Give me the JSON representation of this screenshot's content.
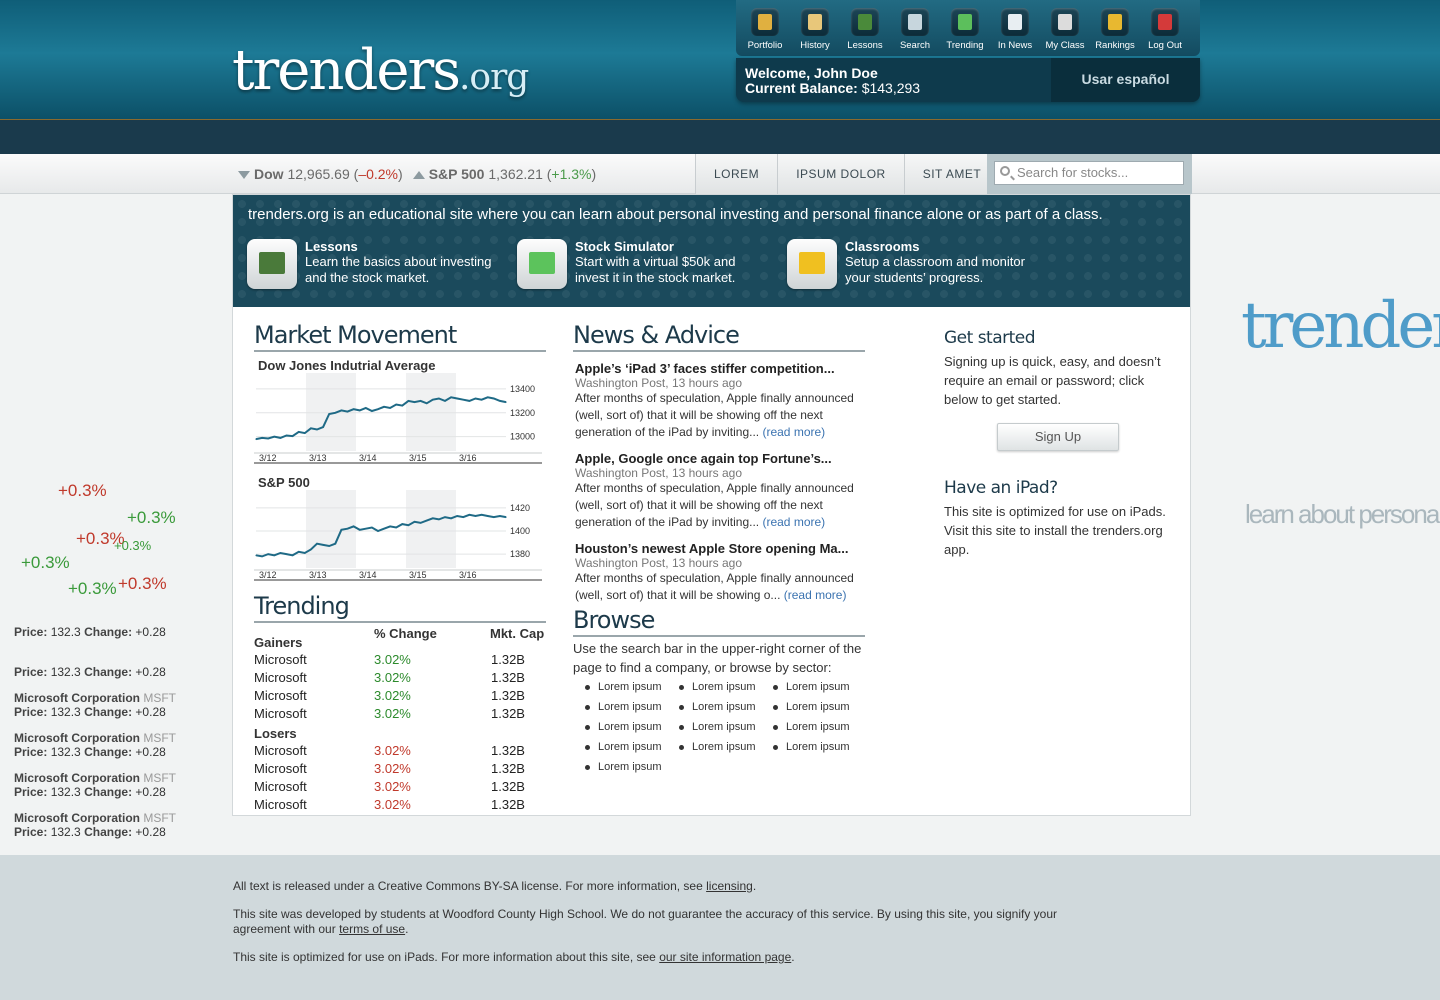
{
  "header": {
    "logo_main": "trenders",
    "logo_tld": ".org",
    "nav": [
      {
        "label": "Portfolio",
        "icon": "portfolio-icon",
        "color": "#e0b040"
      },
      {
        "label": "History",
        "icon": "history-icon",
        "color": "#e8c77a"
      },
      {
        "label": "Lessons",
        "icon": "lessons-icon",
        "color": "#4a8a3a"
      },
      {
        "label": "Search",
        "icon": "search-icon",
        "color": "#c7d6dd"
      },
      {
        "label": "Trending",
        "icon": "trending-icon",
        "color": "#5cbf5c"
      },
      {
        "label": "In News",
        "icon": "news-icon",
        "color": "#e8eef2"
      },
      {
        "label": "My Class",
        "icon": "class-icon",
        "color": "#dcdcdc"
      },
      {
        "label": "Rankings",
        "icon": "rankings-icon",
        "color": "#e8b830"
      },
      {
        "label": "Log Out",
        "icon": "logout-icon",
        "color": "#d43a3a"
      }
    ],
    "welcome": "Welcome, John Doe",
    "balance_label": "Current Balance:",
    "balance_value": "$143,293",
    "language_button": "Usar español"
  },
  "ticker": {
    "dow_label": "Dow",
    "dow_value": "12,965.69",
    "dow_change": "–0.2%",
    "sp_label": "S&P 500",
    "sp_value": "1,362.21",
    "sp_change": "+1.3%",
    "tabs": [
      "LOREM",
      "IPSUM DOLOR",
      "SIT AMET"
    ],
    "search_placeholder": "Search for stocks..."
  },
  "intro": {
    "text": "trenders.org is an educational site where you can learn about personal investing and personal finance alone or as part of a class.",
    "features": [
      {
        "title": "Lessons",
        "desc": "Learn the basics about investing and the stock market.",
        "icon": "chalkboard-icon",
        "color": "#4a7a3a"
      },
      {
        "title": "Stock Simulator",
        "desc": "Start with a virtual $50k and invest it in the stock market.",
        "icon": "chart-icon",
        "color": "#5cc35c"
      },
      {
        "title": "Classrooms",
        "desc": "Setup a classroom and monitor your students’ progress.",
        "icon": "school-bus-icon",
        "color": "#f0c020"
      }
    ]
  },
  "market": {
    "heading": "Market Movement",
    "dow_title": "Dow Jones Indutrial Average",
    "sp_title": "S&P 500"
  },
  "chart_data": [
    {
      "type": "line",
      "title": "Dow Jones Indutrial Average",
      "x_ticks": [
        "3/12",
        "3/13",
        "3/14",
        "3/15",
        "3/16"
      ],
      "y_ticks": [
        13400,
        13200,
        13000
      ],
      "ylim": [
        12880,
        13500
      ],
      "values": [
        12980,
        12990,
        12985,
        13000,
        12990,
        13010,
        13005,
        13040,
        13030,
        13070,
        13060,
        13080,
        13190,
        13200,
        13220,
        13210,
        13230,
        13220,
        13240,
        13215,
        13230,
        13250,
        13240,
        13270,
        13260,
        13300,
        13290,
        13300,
        13280,
        13310,
        13320,
        13300,
        13330,
        13320,
        13310,
        13300,
        13320,
        13310,
        13330,
        13320,
        13300,
        13290
      ]
    },
    {
      "type": "line",
      "title": "S&P 500",
      "x_ticks": [
        "3/12",
        "3/13",
        "3/14",
        "3/15",
        "3/16"
      ],
      "y_ticks": [
        1420,
        1400,
        1380
      ],
      "ylim": [
        1368,
        1432
      ],
      "values": [
        1379,
        1378,
        1380,
        1379,
        1381,
        1380,
        1379,
        1382,
        1381,
        1384,
        1389,
        1388,
        1387,
        1389,
        1401,
        1402,
        1404,
        1401,
        1402,
        1403,
        1400,
        1402,
        1404,
        1403,
        1406,
        1405,
        1408,
        1407,
        1409,
        1411,
        1410,
        1412,
        1411,
        1413,
        1412,
        1414,
        1413,
        1414,
        1413,
        1412,
        1413,
        1412
      ]
    }
  ],
  "trending": {
    "heading": "Trending",
    "col_change": "% Change",
    "col_cap": "Mkt. Cap",
    "gainers_label": "Gainers",
    "losers_label": "Losers",
    "gainers": [
      {
        "name": "Microsoft",
        "change": "3.02%",
        "cap": "1.32B"
      },
      {
        "name": "Microsoft",
        "change": "3.02%",
        "cap": "1.32B"
      },
      {
        "name": "Microsoft",
        "change": "3.02%",
        "cap": "1.32B"
      },
      {
        "name": "Microsoft",
        "change": "3.02%",
        "cap": "1.32B"
      }
    ],
    "losers": [
      {
        "name": "Microsoft",
        "change": "3.02%",
        "cap": "1.32B"
      },
      {
        "name": "Microsoft",
        "change": "3.02%",
        "cap": "1.32B"
      },
      {
        "name": "Microsoft",
        "change": "3.02%",
        "cap": "1.32B"
      },
      {
        "name": "Microsoft",
        "change": "3.02%",
        "cap": "1.32B"
      }
    ]
  },
  "news": {
    "heading": "News & Advice",
    "read_more": "(read more)",
    "items": [
      {
        "title": "Apple’s ‘iPad 3’ faces stiffer competition...",
        "source": "Washington Post, 13 hours ago",
        "body": "After months of speculation, Apple finally announced (well, sort of) that it will be showing off the next generation of the iPad by inviting..."
      },
      {
        "title": "Apple, Google once again top Fortune’s...",
        "source": "Washington Post, 13 hours ago",
        "body": "After months of speculation, Apple finally announced (well, sort of) that it will be showing off the next generation of the iPad by inviting..."
      },
      {
        "title": "Houston’s newest Apple Store opening Ma...",
        "source": "Washington Post, 13 hours ago",
        "body": "After months of speculation, Apple finally announced (well, sort of) that it will be showing o..."
      }
    ]
  },
  "browse": {
    "heading": "Browse",
    "text": "Use the search bar in the upper-right corner of the page to find a company, or browse by sector:",
    "sectors": [
      "Lorem ipsum",
      "Lorem ipsum",
      "Lorem ipsum",
      "Lorem ipsum",
      "Lorem ipsum",
      "Lorem ipsum",
      "Lorem ipsum",
      "Lorem ipsum",
      "Lorem ipsum",
      "Lorem ipsum",
      "Lorem ipsum",
      "Lorem ipsum",
      "Lorem ipsum"
    ]
  },
  "sidebar": {
    "get_started_heading": "Get started",
    "get_started_text": "Signing up is quick, easy, and doesn’t require an email or password; click below to get started.",
    "signup_button": "Sign Up",
    "ipad_heading": "Have an iPad?",
    "ipad_text": "This site is optimized for use on iPads. Visit this site to install the trenders.org app."
  },
  "background_left": {
    "floats": [
      {
        "text": "+0.3%",
        "color": "#c0392b"
      },
      {
        "text": "+0.3%",
        "color": "#3a9a3a"
      },
      {
        "text": "+0.3%",
        "color": "#c0392b"
      },
      {
        "text": "+0.3%",
        "color": "#3a9a3a"
      },
      {
        "text": "+0.3%",
        "color": "#3a9a3a"
      },
      {
        "text": "+0.3%",
        "color": "#3a9a3a"
      },
      {
        "text": "+0.3%",
        "color": "#c0392b"
      }
    ],
    "stocks": [
      {
        "name": "",
        "ticker": "",
        "price_label": "Price:",
        "price": "132.3",
        "change_label": "Change:",
        "change": "+0.28"
      },
      {
        "name": "",
        "ticker": "",
        "price_label": "Price:",
        "price": "132.3",
        "change_label": "Change:",
        "change": "+0.28"
      },
      {
        "name": "Microsoft Corporation",
        "ticker": "MSFT",
        "price_label": "Price:",
        "price": "132.3",
        "change_label": "Change:",
        "change": "+0.28"
      },
      {
        "name": "Microsoft Corporation",
        "ticker": "MSFT",
        "price_label": "Price:",
        "price": "132.3",
        "change_label": "Change:",
        "change": "+0.28"
      },
      {
        "name": "Microsoft Corporation",
        "ticker": "MSFT",
        "price_label": "Price:",
        "price": "132.3",
        "change_label": "Change:",
        "change": "+0.28"
      },
      {
        "name": "Microsoft Corporation",
        "ticker": "MSFT",
        "price_label": "Price:",
        "price": "132.3",
        "change_label": "Change:",
        "change": "+0.28"
      }
    ]
  },
  "background_right": {
    "logo_text": "trenders",
    "tagline": "learn about persona"
  },
  "footer": {
    "license_text": "All text is released under a Creative Commons BY-SA license. For more information, see ",
    "license_link": "licensing",
    "dev_text": "This site was developed by students at Woodford County High School. We do not guarantee the accuracy of this service. By using this site, you signify your agreement with our ",
    "terms_link": "terms of use",
    "ipad_text": "This site is optimized for use on iPads. For more information about this site, see ",
    "info_link": "our site information page"
  }
}
